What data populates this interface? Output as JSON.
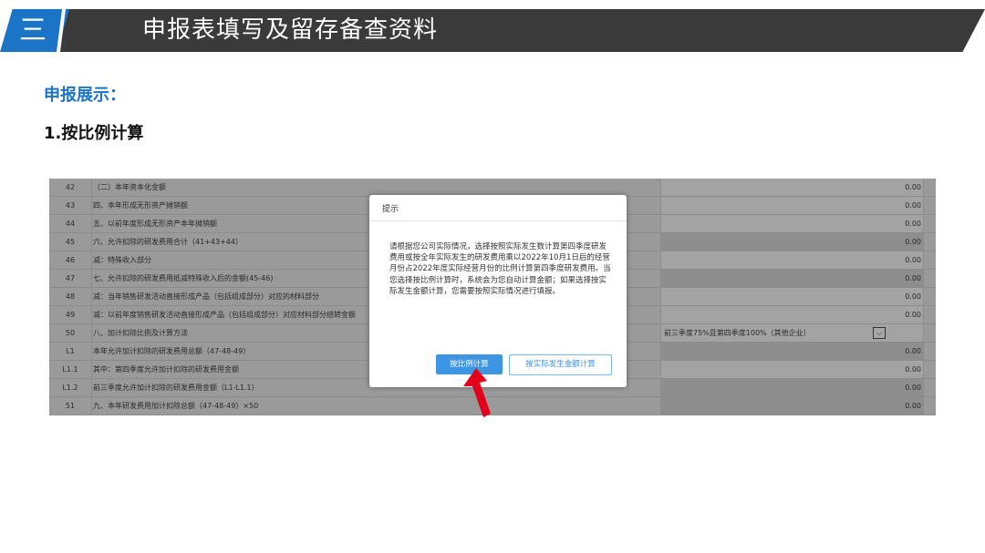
{
  "header": {
    "section_number": "三",
    "title": "申报表填写及留存备查资料"
  },
  "subtitle": "申报展示：",
  "heading": "1.按比例计算",
  "table": {
    "rows": [
      {
        "num": "42",
        "name": "（二）本年资本化金额",
        "value": "0.00",
        "shade": "light"
      },
      {
        "num": "43",
        "name": "四、本年形成无形资产摊销额",
        "value": "0.00",
        "shade": "light"
      },
      {
        "num": "44",
        "name": "五、以前年度形成无形资产本年摊销额",
        "value": "0.00",
        "shade": "light"
      },
      {
        "num": "45",
        "name": "六、允许扣除的研发费用合计（41+43+44）",
        "value": "0.00",
        "shade": "dark"
      },
      {
        "num": "46",
        "name": "减：特殊收入部分",
        "value": "0.00",
        "shade": "light"
      },
      {
        "num": "47",
        "name": "七、允许扣除的研发费用抵减特殊收入后的金额(45-46)",
        "value": "0.00",
        "shade": "dark"
      },
      {
        "num": "48",
        "name": "减：当年销售研发活动直接形成产品（包括组成部分）对应的材料部分",
        "value": "0.00",
        "shade": "light"
      },
      {
        "num": "49",
        "name": "减：以前年度销售研发活动直接形成产品（包括组成部分）对应材料部分结转金额",
        "value": "0.00",
        "shade": "light"
      },
      {
        "num": "50",
        "name": "八、加计扣除比例及计算方法",
        "value": "",
        "shade": "light"
      },
      {
        "num": "L1",
        "name": "本年允许加计扣除的研发费用总额（47-48-49）",
        "value": "0.00",
        "shade": "dark"
      },
      {
        "num": "L1.1",
        "name": "其中：第四季度允许加计扣除的研发费用金额",
        "value": "0.00",
        "shade": "light"
      },
      {
        "num": "L1.2",
        "name": "前三季度允许加计扣除的研发费用金额（L1-L1.1）",
        "value": "0.00",
        "shade": "dark"
      },
      {
        "num": "51",
        "name": "九、本年研发费用加计扣除总额（47-48-49）×50",
        "value": "0.00",
        "shade": "dark"
      }
    ],
    "select_value": "前三季度75%且第四季度100%（其他企业）",
    "select_icon": "chevron-down-icon"
  },
  "dialog": {
    "title": "提示",
    "body": "请根据您公司实际情况，选择按照实际发生数计算第四季度研发费用或按全年实际发生的研发费用乘以2022年10月1日后的经营月份占2022年度实际经营月份的比例计算第四季度研发费用。当您选择按比例计算时，系统会为您自动计算金额；如果选择按实际发生金额计算，您需要按照实际情况进行填报。",
    "primary_button": "按比例计算",
    "secondary_button": "按实际发生金额计算"
  },
  "colors": {
    "accent": "#1b74c6",
    "banner": "#3a3a3a",
    "button": "#3d96e3",
    "arrow": "#e3001b"
  }
}
